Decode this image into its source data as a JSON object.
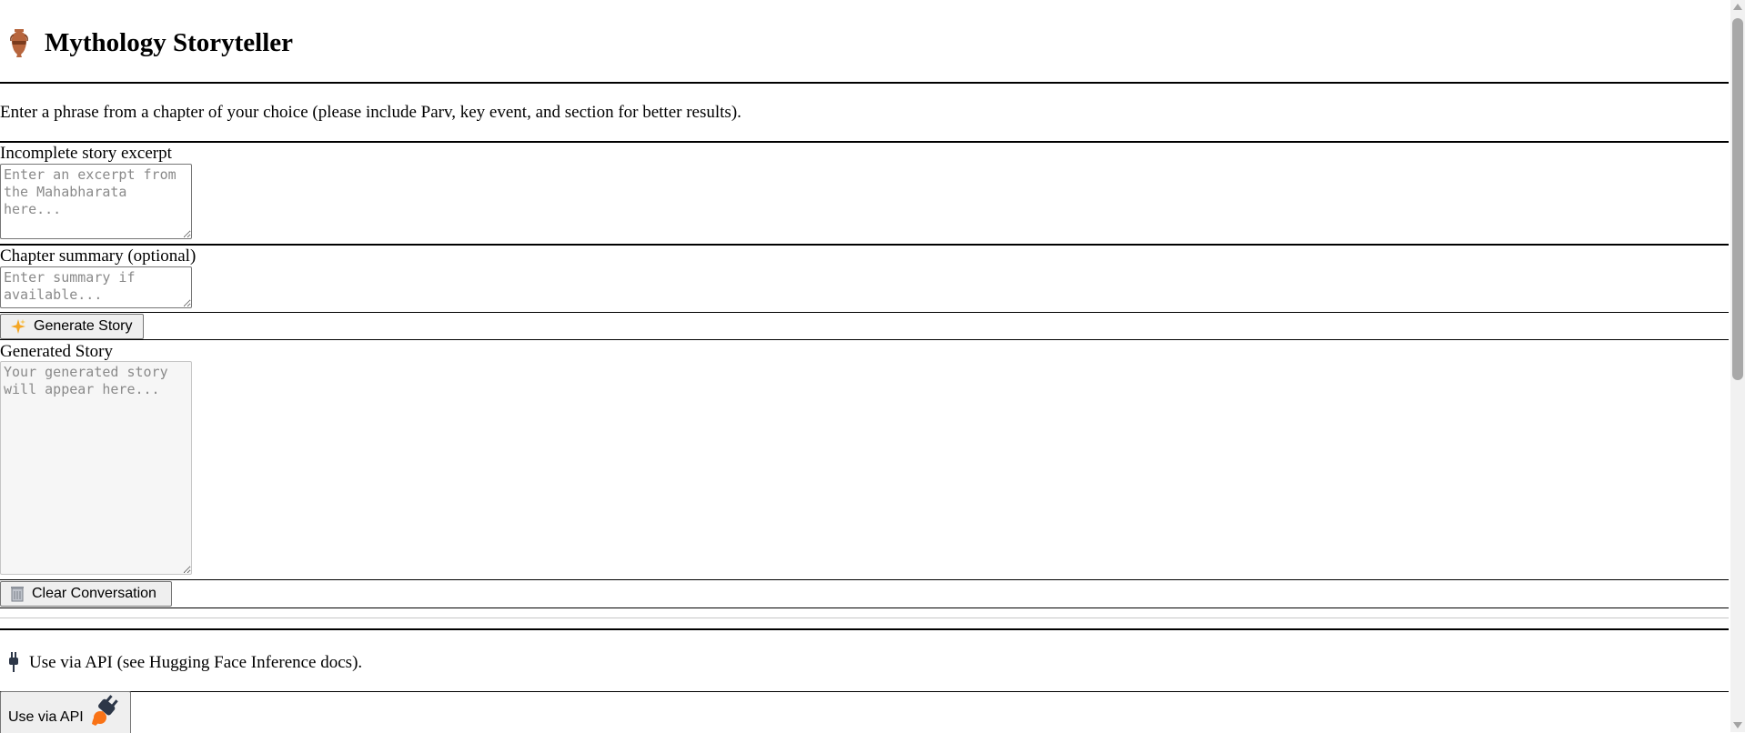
{
  "app": {
    "title": "Mythology Storyteller",
    "icon": "amphora-icon",
    "instructions": "Enter a phrase from a chapter of your choice (please include Parv, key event, and section for better results)."
  },
  "excerpt": {
    "label": "Incomplete story excerpt",
    "placeholder": "Enter an excerpt from the Mahabharata here...",
    "value": ""
  },
  "summary": {
    "label": "Chapter summary (optional)",
    "placeholder": "Enter summary if available...",
    "value": ""
  },
  "generate_button": {
    "label": "Generate Story",
    "icon": "sparkles-icon"
  },
  "output": {
    "label": "Generated Story",
    "placeholder": "Your generated story will appear here...",
    "value": ""
  },
  "clear_button": {
    "label": "Clear Conversation",
    "icon": "wastebasket-icon"
  },
  "api": {
    "note": "Use via API (see Hugging Face Inference docs).",
    "note_icon": "plug-icon",
    "button_label": "Use via API",
    "button_icon": "plug-icon"
  },
  "colors": {
    "amphora": "#b7653d",
    "sparkle": "#f4a623",
    "api_orange": "#f97316",
    "plug_dark": "#2d3748"
  }
}
